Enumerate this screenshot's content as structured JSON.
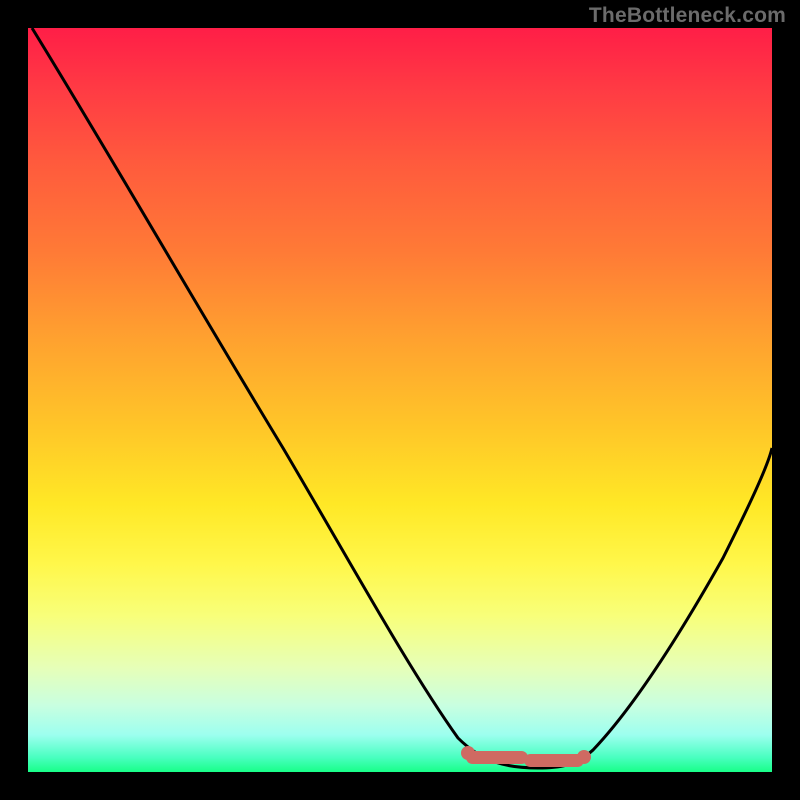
{
  "watermark": "TheBottleneck.com",
  "chart_data": {
    "type": "line",
    "title": "",
    "xlabel": "",
    "ylabel": "",
    "xlim": [
      0,
      100
    ],
    "ylim": [
      0,
      100
    ],
    "grid": false,
    "series": [
      {
        "name": "bottleneck-curve",
        "x": [
          0,
          10,
          20,
          30,
          40,
          50,
          55,
          60,
          63,
          66,
          70,
          74,
          78,
          85,
          92,
          100
        ],
        "values": [
          100,
          86,
          72,
          58,
          44,
          30,
          20,
          10,
          4,
          1,
          0,
          0,
          2,
          12,
          26,
          44
        ]
      }
    ],
    "annotations": [
      {
        "name": "highlight-segment",
        "x_start": 60,
        "x_end": 75,
        "color": "#cf6a62"
      }
    ],
    "background_gradient": {
      "stops": [
        {
          "pos": 0.0,
          "color": "#ff1e47"
        },
        {
          "pos": 0.5,
          "color": "#ffc728"
        },
        {
          "pos": 0.78,
          "color": "#f8ff7a"
        },
        {
          "pos": 1.0,
          "color": "#18ff88"
        }
      ]
    }
  }
}
